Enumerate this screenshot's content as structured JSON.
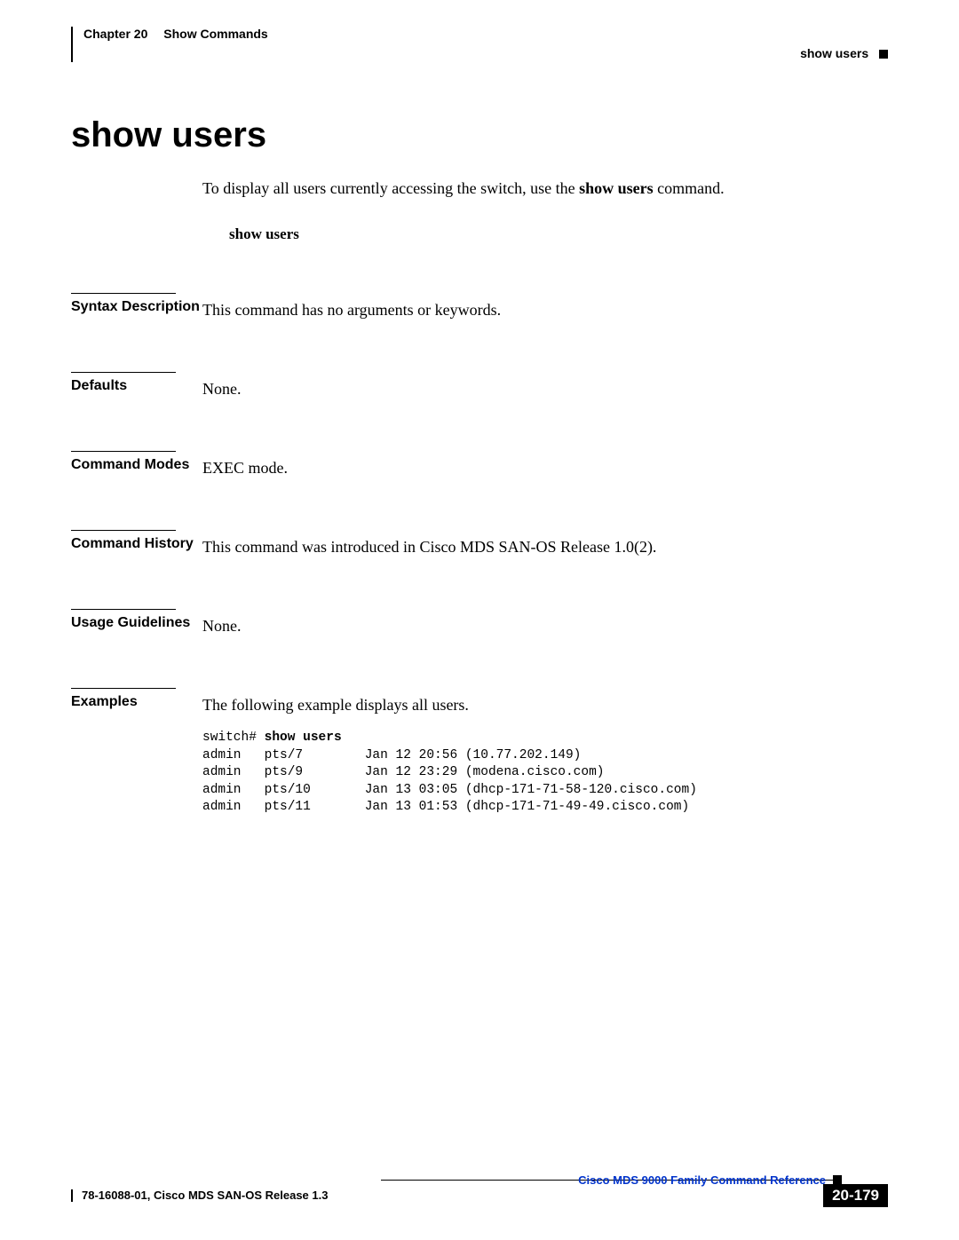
{
  "header": {
    "chapter_label": "Chapter 20",
    "chapter_title": "Show Commands",
    "section_name": "show users"
  },
  "title": "show users",
  "intro": {
    "pre": "To display all users currently accessing the switch, use the ",
    "cmd": "show users",
    "post": " command."
  },
  "syntax_cmd": "show users",
  "sections": {
    "syntax_description": {
      "label": "Syntax Description",
      "content": "This command has no arguments or keywords."
    },
    "defaults": {
      "label": "Defaults",
      "content": "None."
    },
    "command_modes": {
      "label": "Command Modes",
      "content": "EXEC mode."
    },
    "command_history": {
      "label": "Command History",
      "content": "This command was introduced in Cisco MDS SAN-OS Release 1.0(2)."
    },
    "usage_guidelines": {
      "label": "Usage Guidelines",
      "content": "None."
    },
    "examples": {
      "label": "Examples",
      "content": "The following example displays all users."
    }
  },
  "example_output": {
    "prompt": "switch# ",
    "command": "show users",
    "rows": [
      {
        "user": "admin",
        "tty": "pts/7",
        "time": "Jan 12 20:56",
        "host": "(10.77.202.149)"
      },
      {
        "user": "admin",
        "tty": "pts/9",
        "time": "Jan 12 23:29",
        "host": "(modena.cisco.com)"
      },
      {
        "user": "admin",
        "tty": "pts/10",
        "time": "Jan 13 03:05",
        "host": "(dhcp-171-71-58-120.cisco.com)"
      },
      {
        "user": "admin",
        "tty": "pts/11",
        "time": "Jan 13 01:53",
        "host": "(dhcp-171-71-49-49.cisco.com)"
      }
    ]
  },
  "footer": {
    "reference": "Cisco MDS 9000 Family Command Reference",
    "release": "78-16088-01, Cisco MDS SAN-OS Release 1.3",
    "page_num": "20-179"
  }
}
